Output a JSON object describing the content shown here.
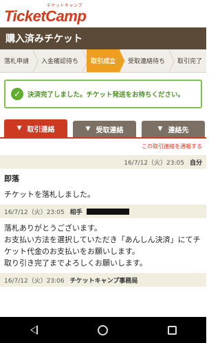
{
  "brand": {
    "logo_text": "TicketCamp",
    "logo_kana": "チケットキャンプ"
  },
  "page_title": "購入済みチケット",
  "steps": [
    {
      "label": "落札申請",
      "active": false
    },
    {
      "label": "入金確認待ち",
      "active": false
    },
    {
      "label": "取引成立",
      "active": true
    },
    {
      "label": "受取連絡待ち",
      "active": false
    },
    {
      "label": "取引完了",
      "active": false
    }
  ],
  "notice": {
    "icon": "check-icon",
    "text": "決済完了しました。チケット発送をお待ちください。"
  },
  "tabs": [
    {
      "label": "取引連絡",
      "active": true
    },
    {
      "label": "受取連絡",
      "active": false
    },
    {
      "label": "連絡先",
      "active": false
    }
  ],
  "notify_link": "この取引連絡を通報する",
  "messages": [
    {
      "timestamp": "16/7/12（火）23:05",
      "sender": "自分",
      "align": "right",
      "lines": [
        "即落",
        "チケットを落札しました。"
      ]
    },
    {
      "timestamp": "16/7/12（火）23:05",
      "sender": "相手",
      "align": "left",
      "redacted": true,
      "lines": [
        "落札ありがとうございます。",
        "お支払い方法を選択していただき「あんしん決済」にてチケット代金のお支払いをお願いします。",
        "取り引き完了までよろしくお願いします。"
      ]
    },
    {
      "timestamp": "16/7/12（火）23:06",
      "sender": "チケットキャンプ事務局",
      "align": "left",
      "lines": []
    }
  ],
  "colors": {
    "brand_red": "#d6381c",
    "header_brown": "#5b4a38",
    "active_step": "#ef9f20",
    "notice_green": "#5fae2f"
  }
}
